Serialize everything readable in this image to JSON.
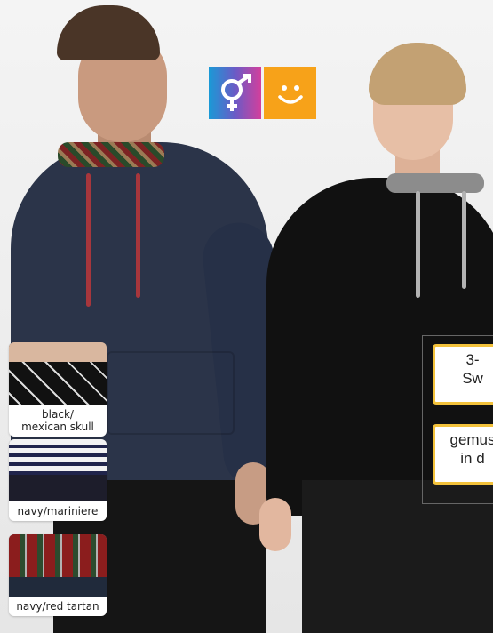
{
  "icons": {
    "unisex": {
      "name": "unisex-gender-icon",
      "colors": [
        "#1a9ad6",
        "#d33f9c"
      ]
    },
    "smile": {
      "name": "smile-icon",
      "color": "#f7a219"
    }
  },
  "swatches": [
    {
      "label_line1": "black/",
      "label_line2": "mexican skull"
    },
    {
      "label_line1": "navy/mariniere"
    },
    {
      "label_line1": "navy/red tartan"
    }
  ],
  "badges": [
    {
      "line1": "3-",
      "line2": "Sw"
    },
    {
      "line1": "gemus",
      "line2": "in d"
    }
  ]
}
